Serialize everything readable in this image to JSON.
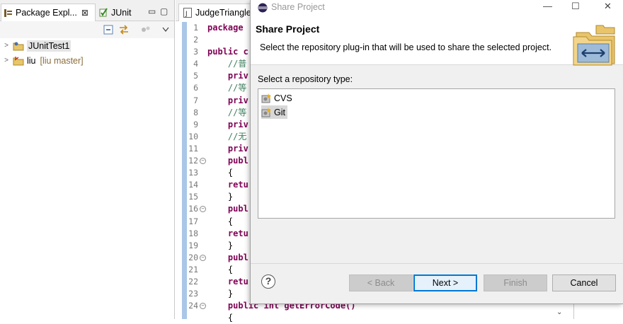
{
  "left_panel": {
    "tabs": [
      {
        "label": "Package Expl...",
        "close": "⊠"
      },
      {
        "label": "JUnit"
      }
    ],
    "window_controls": [
      "▭",
      "▢"
    ],
    "toolbar": [
      "collapse-all-icon",
      "link-with-editor-icon",
      "view-menu-icon",
      "chevron-down-icon"
    ],
    "tree": [
      {
        "label": "JUnitTest1",
        "selected": true
      },
      {
        "label": "liu",
        "decoration": "[liu master]"
      }
    ]
  },
  "editor": {
    "tab_label": "JudgeTriangle",
    "lines": [
      {
        "n": "1",
        "code": "package",
        "fold": ""
      },
      {
        "n": "2",
        "code": "",
        "fold": ""
      },
      {
        "n": "3",
        "code": "public c",
        "fold": ""
      },
      {
        "n": "4",
        "code": "    //普",
        "fold": ""
      },
      {
        "n": "5",
        "code": "    priv",
        "fold": ""
      },
      {
        "n": "6",
        "code": "    //等",
        "fold": ""
      },
      {
        "n": "7",
        "code": "    priv",
        "fold": ""
      },
      {
        "n": "8",
        "code": "    //等",
        "fold": ""
      },
      {
        "n": "9",
        "code": "    priv",
        "fold": ""
      },
      {
        "n": "10",
        "code": "    //无",
        "fold": ""
      },
      {
        "n": "11",
        "code": "    priv",
        "fold": ""
      },
      {
        "n": "12",
        "code": "    publ",
        "fold": "⊖"
      },
      {
        "n": "13",
        "code": "    {",
        "fold": ""
      },
      {
        "n": "14",
        "code": "    retu",
        "fold": ""
      },
      {
        "n": "15",
        "code": "    }",
        "fold": ""
      },
      {
        "n": "16",
        "code": "    publ",
        "fold": "⊖"
      },
      {
        "n": "17",
        "code": "    {",
        "fold": ""
      },
      {
        "n": "18",
        "code": "    retu",
        "fold": ""
      },
      {
        "n": "19",
        "code": "    }",
        "fold": ""
      },
      {
        "n": "20",
        "code": "    publ",
        "fold": "⊖"
      },
      {
        "n": "21",
        "code": "    {",
        "fold": ""
      },
      {
        "n": "22",
        "code": "    retu",
        "fold": ""
      },
      {
        "n": "23",
        "code": "    }",
        "fold": ""
      },
      {
        "n": "24",
        "code": "    public int getErrorCode()",
        "fold": "⊖"
      },
      {
        "n": "",
        "code": "    {",
        "fold": ""
      }
    ]
  },
  "dialog": {
    "window_title": "Share Project",
    "window_buttons": {
      "minimize": "—",
      "maximize": "☐",
      "close": "✕"
    },
    "heading": "Share Project",
    "description": "Select the repository plug-in that will be used to share the selected project.",
    "prompt": "Select a repository type:",
    "repository_types": [
      {
        "label": "CVS",
        "selected": false
      },
      {
        "label": "Git",
        "selected": true
      }
    ],
    "help": "?",
    "buttons": {
      "back": "< Back",
      "next": "Next >",
      "finish": "Finish",
      "cancel": "Cancel"
    }
  }
}
